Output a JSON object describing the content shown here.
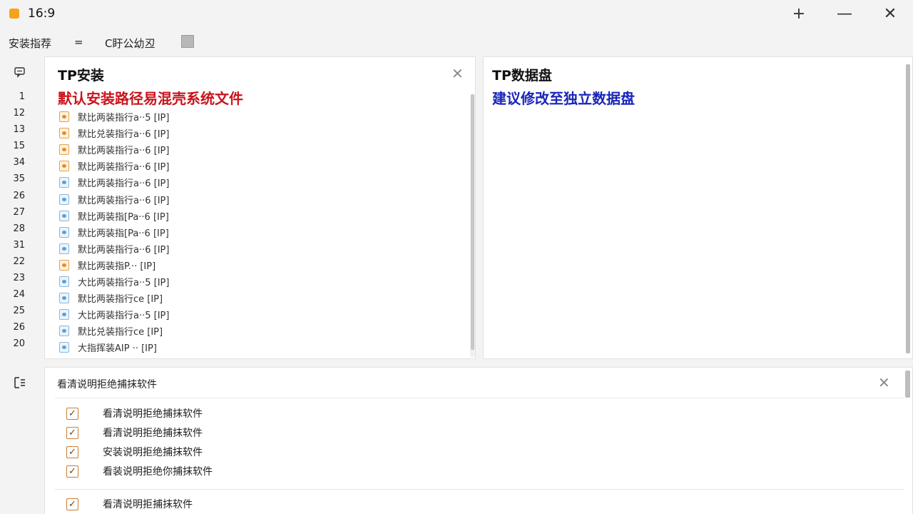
{
  "window": {
    "title": "16:9",
    "controls": [
      "+",
      "—",
      "✕"
    ]
  },
  "toolbar": {
    "items": [
      "安装指荐",
      "=",
      "C盱公幼丒"
    ]
  },
  "left_panel": {
    "title": "TP安装",
    "warning": "默认安装路径易混壳系统文件",
    "line_numbers": [
      "1",
      "12",
      "13",
      "15",
      "34",
      "35",
      "26",
      "27",
      "28",
      "31",
      "22",
      "23",
      "24",
      "25",
      "26",
      "20"
    ],
    "files": [
      {
        "name": "默比两装指行a··5 [IP]",
        "icon": "orange"
      },
      {
        "name": "默比兑装指行a··6 [IP]",
        "icon": "orange"
      },
      {
        "name": "默比两装指行a··6 [IP]",
        "icon": "orange"
      },
      {
        "name": "默比两装指行a··6 [IP]",
        "icon": "orange"
      },
      {
        "name": "默比两装指行a··6 [IP]",
        "icon": "blue"
      },
      {
        "name": "默比两装指行a··6 [IP]",
        "icon": "blue"
      },
      {
        "name": "默比两装指[Pa··6 [IP]",
        "icon": "blue"
      },
      {
        "name": "默比两装指[Pa··6 [IP]",
        "icon": "blue"
      },
      {
        "name": "默比两装指行a··6 [IP]",
        "icon": "blue"
      },
      {
        "name": "默比两装指P.··  [IP]",
        "icon": "orange"
      },
      {
        "name": "大比两装指行a··5 [IP]",
        "icon": "blue"
      },
      {
        "name": "默比两装指行ce  [IP]",
        "icon": "blue"
      },
      {
        "name": "大比两装指行a··5 [IP]",
        "icon": "blue"
      },
      {
        "name": "默比兑装指行ce  [IP]",
        "icon": "blue"
      },
      {
        "name": "大指挥装AIP ··  [IP]",
        "icon": "blue"
      }
    ]
  },
  "right_panel": {
    "title": "TP数据盘",
    "warning": "建议修改至独立数据盘"
  },
  "bottom_panel": {
    "title": "看清说明拒绝捕抹软件",
    "items": [
      "看清说明拒绝捕抹软件",
      "看清说明拒绝捕抹软件",
      "安装说明拒绝捕抹软件",
      "看装说明拒绝你捕抹软件",
      "看清说明拒捕抹软件"
    ]
  },
  "colors": {
    "warning_red": "#c9141c",
    "warning_blue": "#1a25b8",
    "accent_orange": "#f7a21b"
  },
  "icons": {
    "app": "app-icon",
    "left_gutter_top": "comment-icon",
    "left_gutter_bottom": "list-icon"
  }
}
